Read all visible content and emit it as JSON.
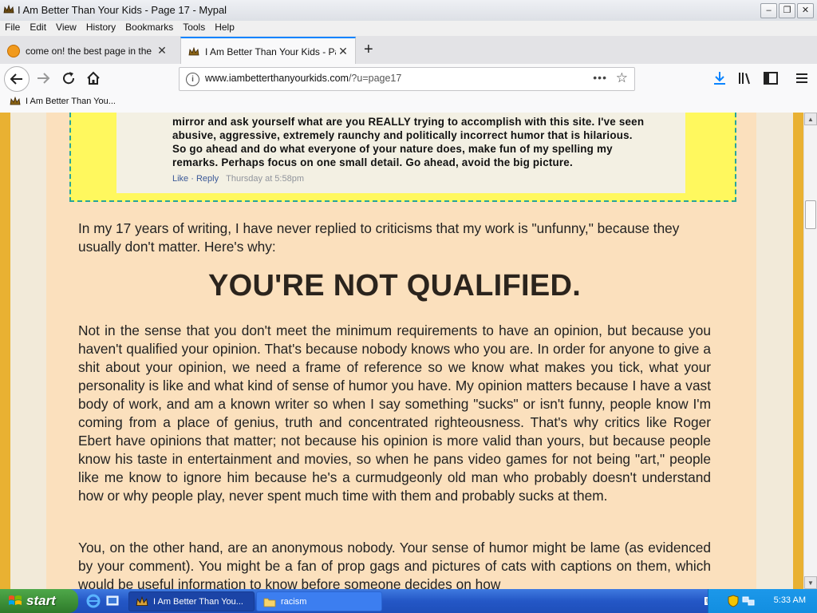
{
  "window": {
    "title": "I Am Better Than Your Kids - Page 17 - Mypal",
    "controls": [
      "minimize",
      "restore",
      "close"
    ]
  },
  "menu": [
    "File",
    "Edit",
    "View",
    "History",
    "Bookmarks",
    "Tools",
    "Help"
  ],
  "tabs": [
    {
      "label": "come on! the best page in the uni",
      "icon": "site-icon",
      "active": false
    },
    {
      "label": "I Am Better Than Your Kids - Page",
      "icon": "crown-icon",
      "active": true
    }
  ],
  "addressbar": {
    "domain": "www.iambetterthanyourkids.com",
    "path": "/?u=page17"
  },
  "bookmarks": [
    {
      "label": "I Am Better Than You...",
      "icon": "crown-icon"
    }
  ],
  "comment": {
    "lines": [
      "mirror and ask yourself what are you REALLY trying to accomplish with this site. I've seen",
      "abusive, aggressive, extremely raunchy and politically incorrect humor that is hilarious.",
      "So go ahead and do what everyone of your nature does, make fun of my spelling my",
      "remarks. Perhaps focus on one small detail. Go ahead, avoid the big picture."
    ],
    "like": "Like",
    "separator": "·",
    "reply": "Reply",
    "time": "Thursday at 5:58pm"
  },
  "article": {
    "intro": "In my 17 years of writing, I have never replied to criticisms that my work is \"unfunny,\" because they usually don't matter. Here's why:",
    "heading": "YOU'RE NOT QUALIFIED.",
    "paragraph1": "Not in the sense that you don't meet the minimum requirements to have an opinion, but because you haven't qualified your opinion. That's because nobody knows who you are. In order for anyone to give a shit about your opinion, we need a frame of reference so we know what makes you tick, what your personality is like and what kind of sense of humor you have. My opinion matters because I have a vast body of work, and am a known writer so when I say something \"sucks\" or isn't funny, people know I'm coming from a place of genius, truth and concentrated righteousness. That's why critics like Roger Ebert have opinions that matter; not because his opinion is more valid than yours, but because people know his taste in entertainment and movies, so when he pans video games for not being \"art,\" people like me know to ignore him because he's a curmudgeonly old man who probably doesn't understand how or why people play, never spent much time with them and probably sucks at them.",
    "paragraph2": "You, on the other hand, are an anonymous nobody. Your sense of humor might be lame (as evidenced by your comment). You might be a fan of prop gags and pictures of cats with captions on them, which would be useful information to know before someone decides on how"
  },
  "taskbar": {
    "start": "start",
    "items": [
      {
        "label": "I Am Better Than You...",
        "icon": "browser-icon",
        "active": true
      },
      {
        "label": "racism",
        "icon": "folder-icon",
        "active": false
      }
    ],
    "clock": "5:33 AM"
  },
  "colors": {
    "page_side": "#e9b132",
    "content_bg": "#fbe0bd",
    "comment_bg": "#fff85e",
    "accent": "#0a84ff"
  }
}
